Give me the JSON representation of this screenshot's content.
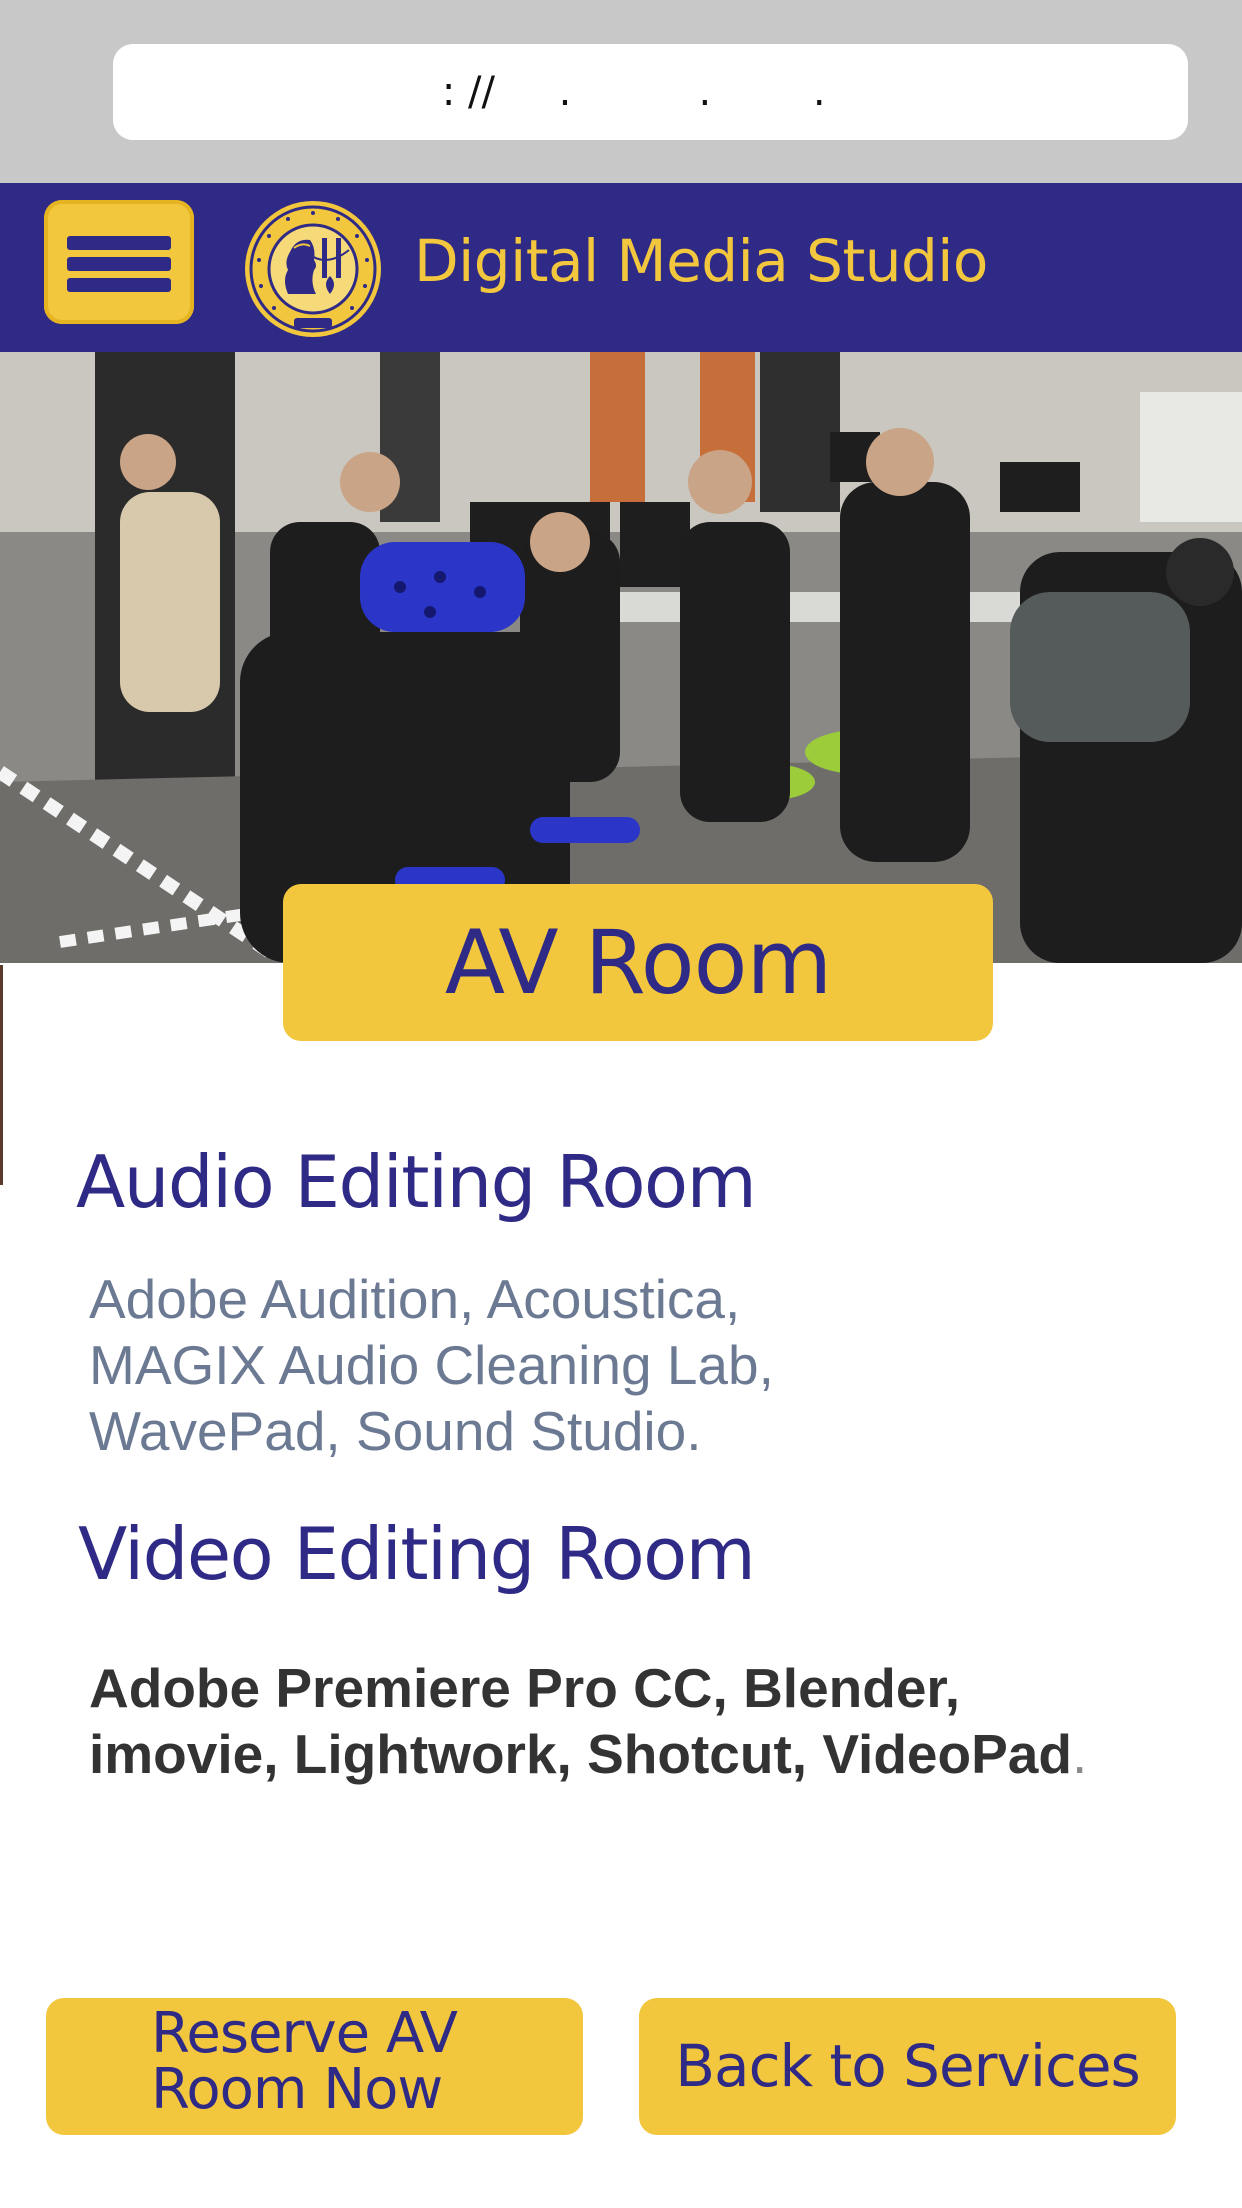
{
  "browser": {
    "url_text": "    : //     .          .        ."
  },
  "header": {
    "site_title": "Digital Media Studio",
    "brand_color": "#2e2a85",
    "accent_color": "#f2c73d"
  },
  "hero": {
    "badge_label": "AV Room"
  },
  "sections": {
    "audio": {
      "heading": "Audio Editing Room",
      "lines": [
        "Adobe Audition, Acoustica,",
        "MAGIX Audio Cleaning Lab,",
        "WavePad, Sound Studio."
      ]
    },
    "video": {
      "heading": "Video Editing Room",
      "lines": [
        "Adobe Premiere Pro CC, Blender,",
        "imovie, Lightwork, Shotcut, VideoPad"
      ],
      "trailing_punctuation": "."
    }
  },
  "actions": {
    "reserve_line1": "Reserve AV",
    "reserve_line2": "Room Now",
    "back_label": "Back to Services"
  },
  "icons": {
    "menu": "hamburger-menu-icon",
    "seal": "university-seal-logo"
  }
}
